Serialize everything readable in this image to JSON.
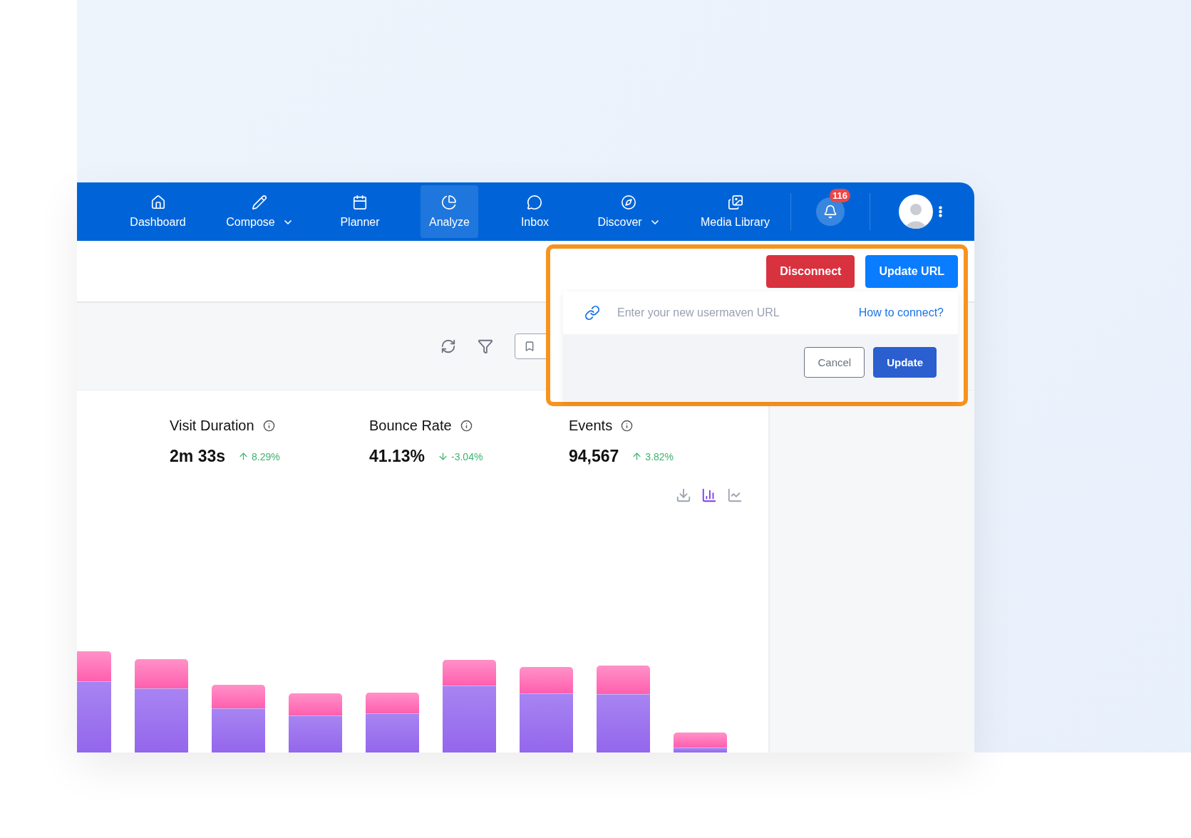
{
  "nav": {
    "items": [
      {
        "label": "Dashboard",
        "has_menu": false,
        "selected": false
      },
      {
        "label": "Compose",
        "has_menu": true,
        "selected": false
      },
      {
        "label": "Planner",
        "has_menu": false,
        "selected": false
      },
      {
        "label": "Analyze",
        "has_menu": false,
        "selected": true
      },
      {
        "label": "Inbox",
        "has_menu": false,
        "selected": false
      },
      {
        "label": "Discover",
        "has_menu": true,
        "selected": false
      },
      {
        "label": "Media Library",
        "has_menu": false,
        "selected": false
      }
    ],
    "notifications": {
      "count": "116"
    }
  },
  "metrics": [
    {
      "label": "Visit Duration",
      "value": "2m 33s",
      "change": "8.29%",
      "kind": "up"
    },
    {
      "label": "Bounce Rate",
      "value": "41.13%",
      "change": "-3.04%",
      "kind": "down"
    },
    {
      "label": "Events",
      "value": "94,567",
      "change": "3.82%",
      "kind": "up"
    }
  ],
  "chart_tools": [
    {
      "kind": "download",
      "selected": false
    },
    {
      "kind": "bar",
      "selected": true
    },
    {
      "kind": "line",
      "selected": false
    }
  ],
  "connect_popover": {
    "buttons": [
      {
        "kind": "danger",
        "label": "Disconnect"
      },
      {
        "kind": "primary",
        "label": "Update URL"
      }
    ],
    "url_field": {
      "placeholder": "Enter your new usermaven URL"
    },
    "help_link": "How to connect?",
    "actions": [
      {
        "kind": "secondary",
        "label": "Cancel"
      },
      {
        "kind": "confirm",
        "label": "Update"
      }
    ]
  }
}
